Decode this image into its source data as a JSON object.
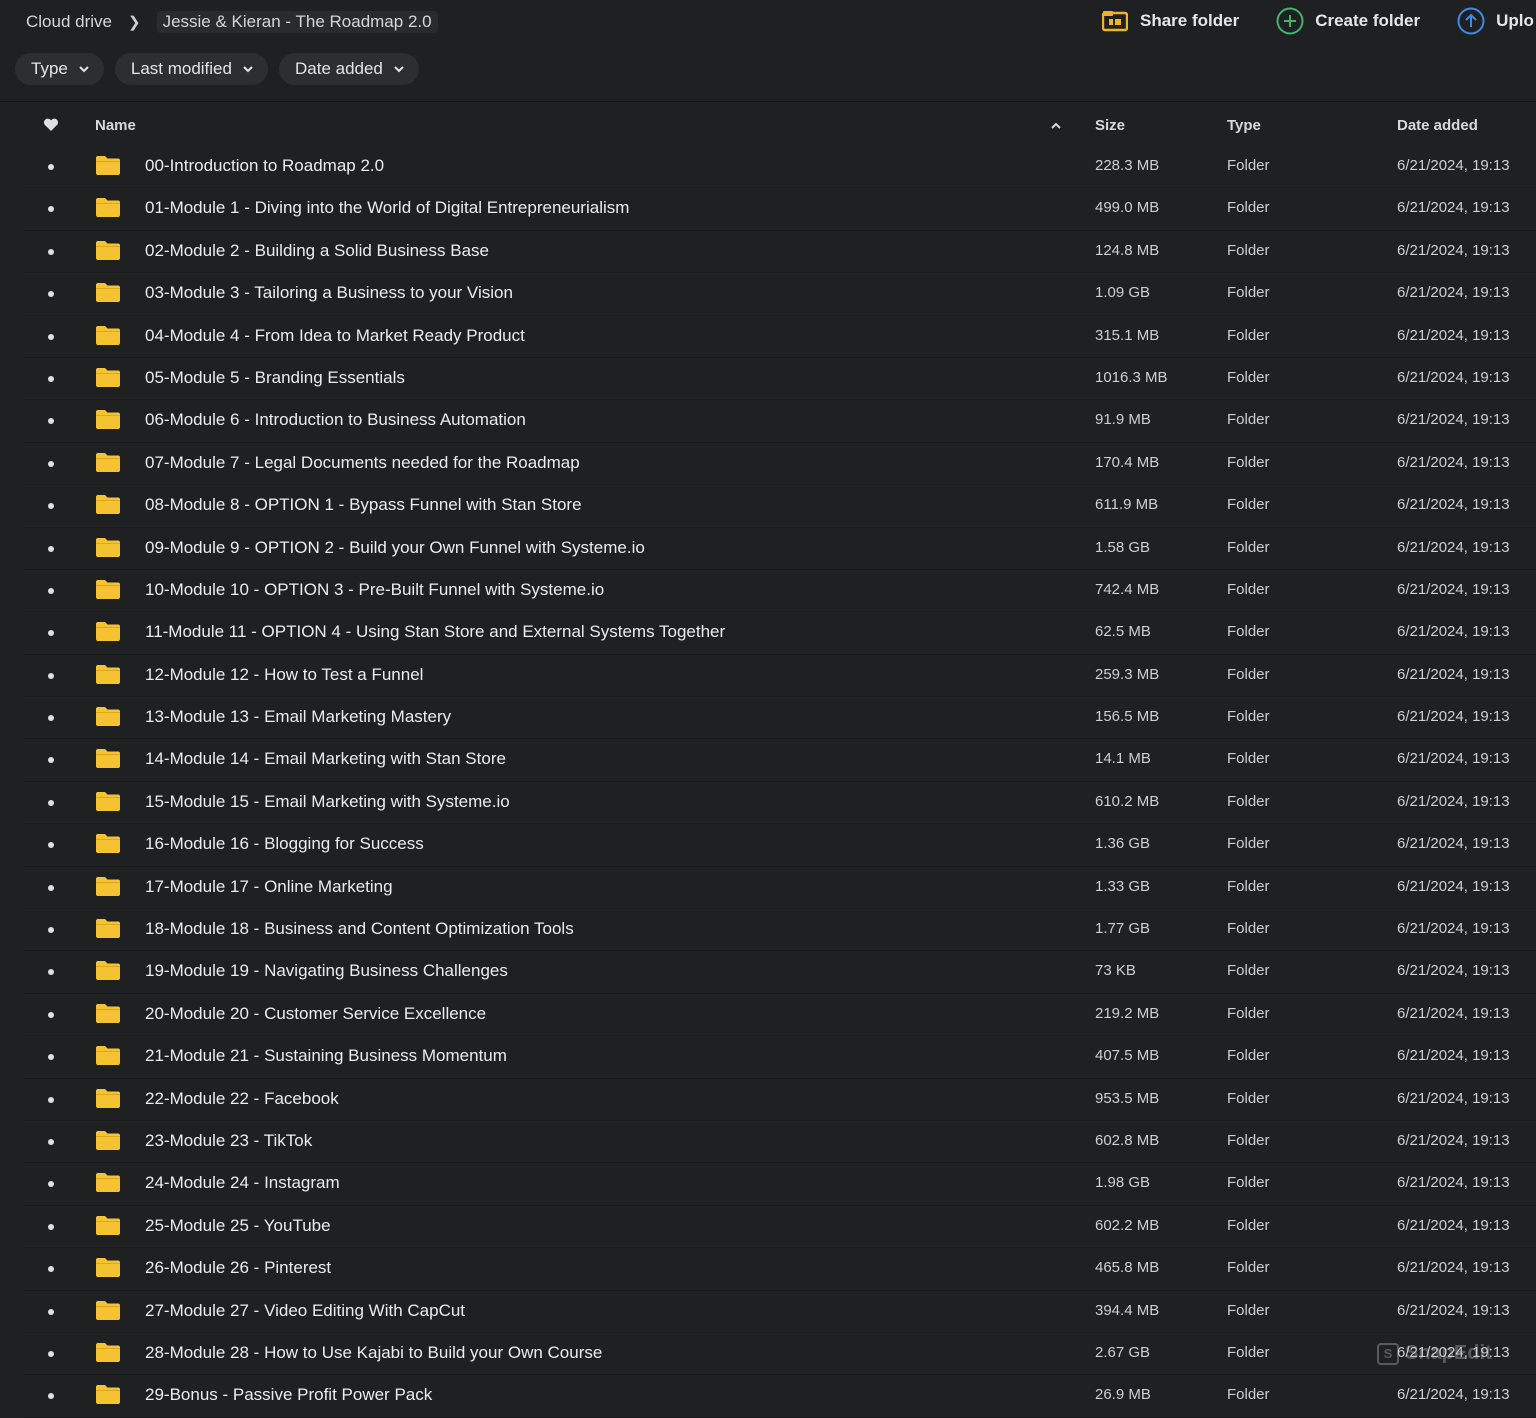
{
  "breadcrumb": {
    "root": "Cloud drive",
    "current": "Jessie & Kieran - The Roadmap 2.0"
  },
  "actions": {
    "share": "Share folder",
    "create": "Create folder",
    "upload": "Uplo"
  },
  "filters": {
    "type": "Type",
    "last_modified": "Last modified",
    "date_added": "Date added"
  },
  "columns": {
    "name": "Name",
    "size": "Size",
    "type": "Type",
    "date_added": "Date added"
  },
  "colors": {
    "background": "#1f2022",
    "folder": "#f5c231",
    "share_icon": "#f2b322",
    "create_icon": "#3fb56a",
    "upload_icon": "#3d8be8"
  },
  "rows": [
    {
      "name": "00-Introduction to Roadmap 2.0",
      "size": "228.3 MB",
      "type": "Folder",
      "date": "6/21/2024, 19:13"
    },
    {
      "name": "01-Module 1 - Diving into the World of Digital Entrepreneurialism",
      "size": "499.0 MB",
      "type": "Folder",
      "date": "6/21/2024, 19:13"
    },
    {
      "name": "02-Module 2 - Building a Solid Business Base",
      "size": "124.8 MB",
      "type": "Folder",
      "date": "6/21/2024, 19:13"
    },
    {
      "name": "03-Module 3 - Tailoring a Business to your Vision",
      "size": "1.09 GB",
      "type": "Folder",
      "date": "6/21/2024, 19:13"
    },
    {
      "name": "04-Module 4 - From Idea to Market Ready Product",
      "size": "315.1 MB",
      "type": "Folder",
      "date": "6/21/2024, 19:13"
    },
    {
      "name": "05-Module 5 - Branding Essentials",
      "size": "1016.3 MB",
      "type": "Folder",
      "date": "6/21/2024, 19:13"
    },
    {
      "name": "06-Module 6 - Introduction to Business Automation",
      "size": "91.9 MB",
      "type": "Folder",
      "date": "6/21/2024, 19:13"
    },
    {
      "name": "07-Module 7 - Legal Documents needed for the Roadmap",
      "size": "170.4 MB",
      "type": "Folder",
      "date": "6/21/2024, 19:13"
    },
    {
      "name": "08-Module 8 - OPTION 1 - Bypass Funnel with Stan Store",
      "size": "611.9 MB",
      "type": "Folder",
      "date": "6/21/2024, 19:13"
    },
    {
      "name": "09-Module 9 - OPTION 2 - Build your Own Funnel with Systeme.io",
      "size": "1.58 GB",
      "type": "Folder",
      "date": "6/21/2024, 19:13"
    },
    {
      "name": "10-Module 10 - OPTION 3 - Pre-Built Funnel with Systeme.io",
      "size": "742.4 MB",
      "type": "Folder",
      "date": "6/21/2024, 19:13"
    },
    {
      "name": "11-Module 11 - OPTION 4 - Using Stan Store and External Systems Together",
      "size": "62.5 MB",
      "type": "Folder",
      "date": "6/21/2024, 19:13"
    },
    {
      "name": "12-Module 12 - How to Test a Funnel",
      "size": "259.3 MB",
      "type": "Folder",
      "date": "6/21/2024, 19:13"
    },
    {
      "name": "13-Module 13 - Email Marketing Mastery",
      "size": "156.5 MB",
      "type": "Folder",
      "date": "6/21/2024, 19:13"
    },
    {
      "name": "14-Module 14 - Email Marketing with Stan Store",
      "size": "14.1 MB",
      "type": "Folder",
      "date": "6/21/2024, 19:13"
    },
    {
      "name": "15-Module 15 - Email Marketing with Systeme.io",
      "size": "610.2 MB",
      "type": "Folder",
      "date": "6/21/2024, 19:13"
    },
    {
      "name": "16-Module 16 - Blogging for Success",
      "size": "1.36 GB",
      "type": "Folder",
      "date": "6/21/2024, 19:13"
    },
    {
      "name": "17-Module 17 - Online Marketing",
      "size": "1.33 GB",
      "type": "Folder",
      "date": "6/21/2024, 19:13"
    },
    {
      "name": "18-Module 18 - Business and Content Optimization Tools",
      "size": "1.77 GB",
      "type": "Folder",
      "date": "6/21/2024, 19:13"
    },
    {
      "name": "19-Module 19 - Navigating Business Challenges",
      "size": "73 KB",
      "type": "Folder",
      "date": "6/21/2024, 19:13"
    },
    {
      "name": "20-Module 20 - Customer Service Excellence",
      "size": "219.2 MB",
      "type": "Folder",
      "date": "6/21/2024, 19:13"
    },
    {
      "name": "21-Module 21 - Sustaining Business Momentum",
      "size": "407.5 MB",
      "type": "Folder",
      "date": "6/21/2024, 19:13"
    },
    {
      "name": "22-Module 22 - Facebook",
      "size": "953.5 MB",
      "type": "Folder",
      "date": "6/21/2024, 19:13"
    },
    {
      "name": "23-Module 23 - TikTok",
      "size": "602.8 MB",
      "type": "Folder",
      "date": "6/21/2024, 19:13"
    },
    {
      "name": "24-Module 24 - Instagram",
      "size": "1.98 GB",
      "type": "Folder",
      "date": "6/21/2024, 19:13"
    },
    {
      "name": "25-Module 25 - YouTube",
      "size": "602.2 MB",
      "type": "Folder",
      "date": "6/21/2024, 19:13"
    },
    {
      "name": "26-Module 26 - Pinterest",
      "size": "465.8 MB",
      "type": "Folder",
      "date": "6/21/2024, 19:13"
    },
    {
      "name": "27-Module 27 - Video Editing With CapCut",
      "size": "394.4 MB",
      "type": "Folder",
      "date": "6/21/2024, 19:13"
    },
    {
      "name": "28-Module 28 - How to Use Kajabi to Build your Own Course",
      "size": "2.67 GB",
      "type": "Folder",
      "date": "6/21/2024, 19:13"
    },
    {
      "name": "29-Bonus - Passive Profit Power Pack",
      "size": "26.9 MB",
      "type": "Folder",
      "date": "6/21/2024, 19:13"
    }
  ],
  "watermark": "SnapEdit"
}
